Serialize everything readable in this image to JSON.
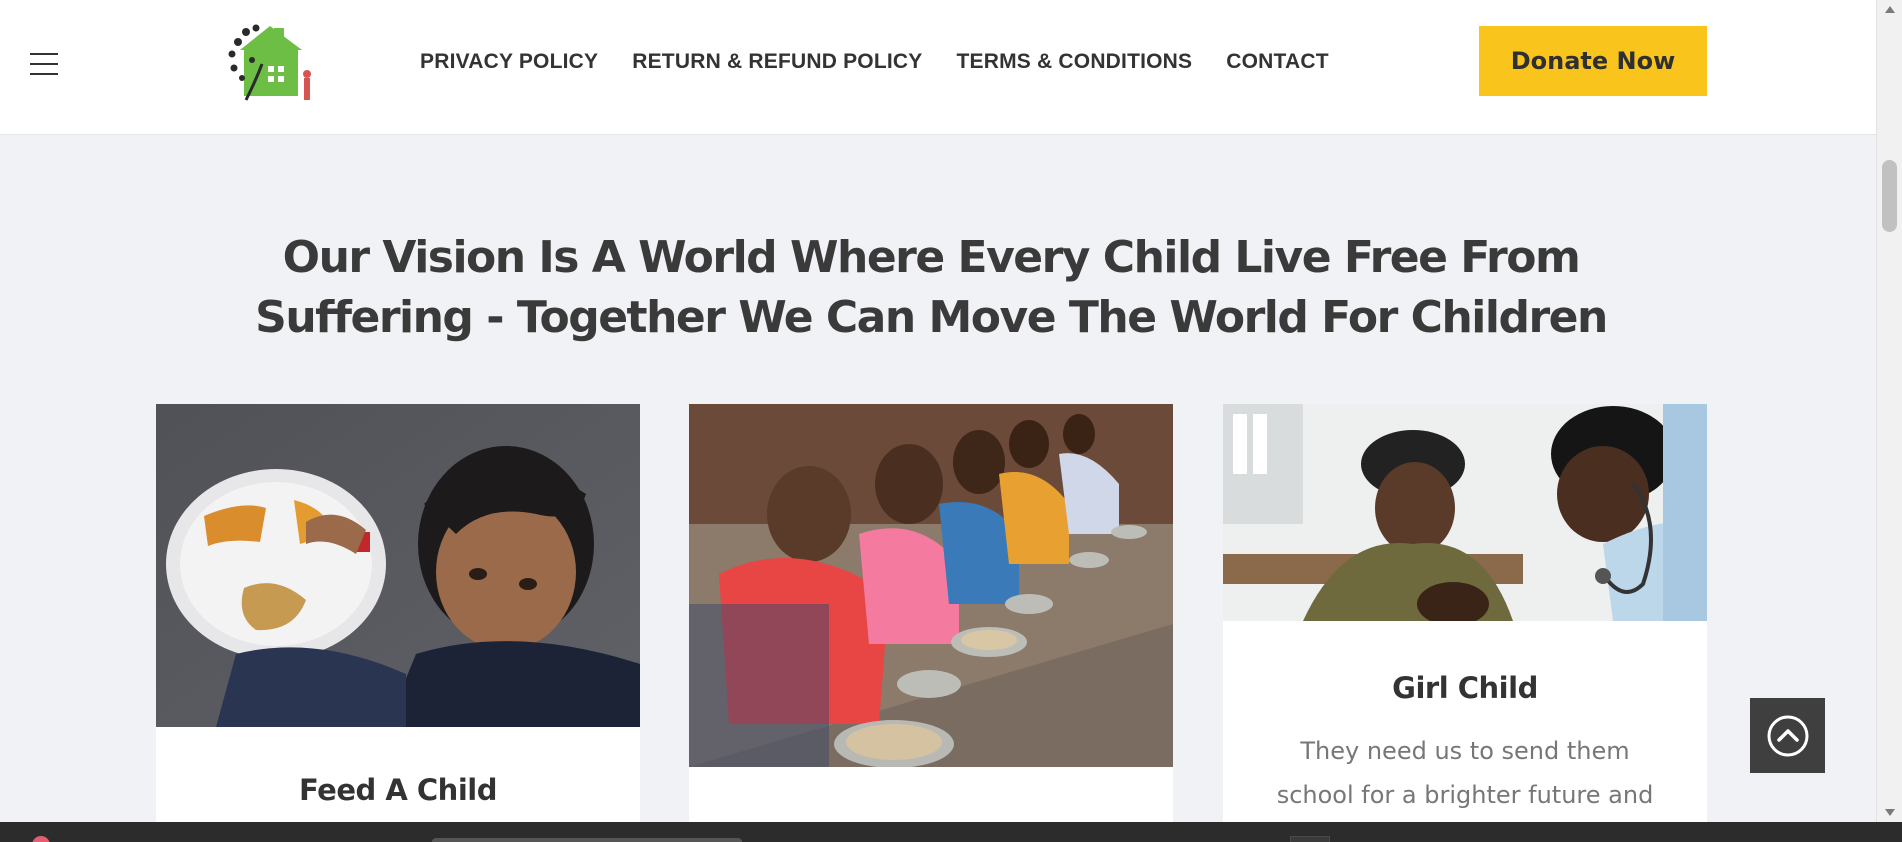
{
  "header": {
    "nav": [
      {
        "label": "PRIVACY POLICY"
      },
      {
        "label": "RETURN & REFUND POLICY"
      },
      {
        "label": "TERMS & CONDITIONS"
      },
      {
        "label": "CONTACT"
      }
    ],
    "donate_label": "Donate Now"
  },
  "main": {
    "headline_line1": "Our Vision Is A World Where Every Child Live Free From",
    "headline_line2": "Suffering - Together We Can Move The World For Children",
    "cards": [
      {
        "title": "Feed A Child",
        "description": ""
      },
      {
        "title": "",
        "description": ""
      },
      {
        "title": "Girl Child",
        "description": "They need us to send them school for a brighter future and"
      }
    ]
  },
  "colors": {
    "accent": "#f9c51c",
    "page_bg": "#f1f2f6",
    "text": "#333333"
  },
  "icons": {
    "menu": "hamburger-icon",
    "to_top": "chevron-up-circle-icon"
  }
}
